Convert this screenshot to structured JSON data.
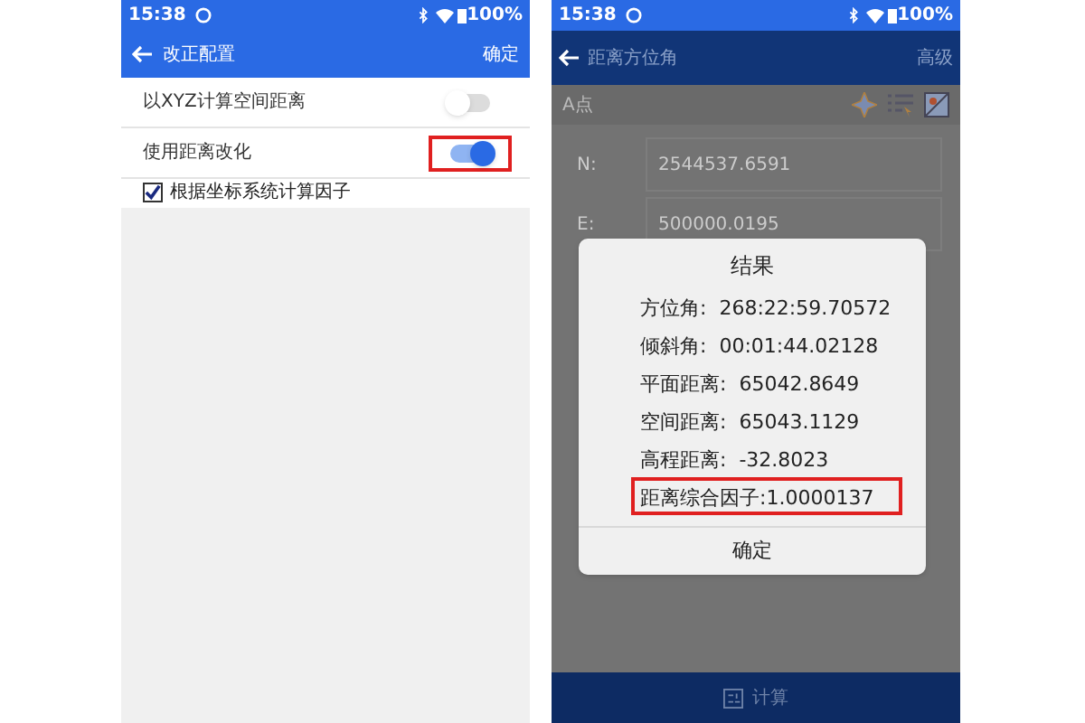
{
  "left_screen": {
    "status_bar": {
      "time": "15:38",
      "battery": "100%"
    },
    "app_bar": {
      "title": "改正配置",
      "action": "确定"
    },
    "settings": [
      {
        "kind": "toggle",
        "label": "以XYZ计算空间距离",
        "on": false,
        "highlighted": false
      },
      {
        "kind": "toggle",
        "label": "使用距离改化",
        "on": true,
        "highlighted": true
      },
      {
        "kind": "checkbox",
        "label": "根据坐标系统计算因子",
        "checked": true
      }
    ]
  },
  "right_screen": {
    "status_bar": {
      "time": "15:38",
      "battery": "100%"
    },
    "app_bar": {
      "title": "距离方位角",
      "action": "高级"
    },
    "section": "A点",
    "fields": [
      {
        "label": "N:",
        "value": "2544537.6591"
      },
      {
        "label": "E:",
        "value": "500000.0195"
      }
    ],
    "dialog": {
      "title": "结果",
      "lines": [
        {
          "text": "方位角:  268:22:59.70572",
          "highlighted": false
        },
        {
          "text": "倾斜角:  00:01:44.02128",
          "highlighted": false
        },
        {
          "text": "平面距离:  65042.8649",
          "highlighted": false
        },
        {
          "text": "空间距离:  65043.1129",
          "highlighted": false
        },
        {
          "text": "高程距离:  -32.8023",
          "highlighted": false
        },
        {
          "text": "距离综合因子:1.0000137",
          "highlighted": true
        }
      ],
      "button": "确定"
    },
    "bottom_button": "计算"
  }
}
